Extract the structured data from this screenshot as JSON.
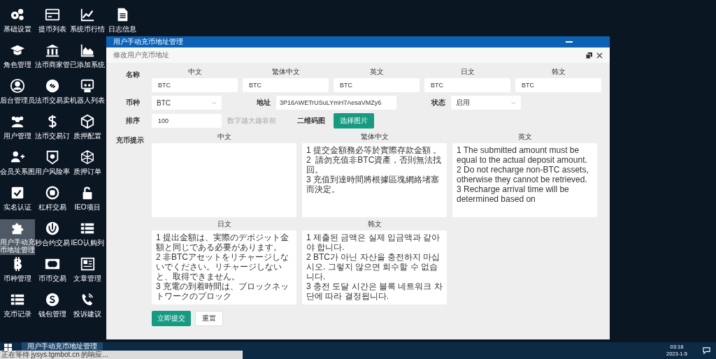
{
  "shortcut_rows": [
    {
      "items": [
        {
          "label": "基础设置",
          "selected": false
        },
        {
          "label": "提币列表",
          "selected": false
        },
        {
          "label": "系统币行情",
          "selected": false
        },
        {
          "label": "日志信息",
          "selected": false
        }
      ]
    },
    {
      "items": [
        {
          "label": "角色管理",
          "selected": false
        },
        {
          "label": "法币商家管",
          "selected": false
        },
        {
          "label": "已添加系统",
          "selected": false
        }
      ]
    },
    {
      "items": [
        {
          "label": "后台管理员",
          "selected": false
        },
        {
          "label": "法币交易卖",
          "selected": false
        },
        {
          "label": "机器人列表",
          "selected": false
        }
      ]
    },
    {
      "items": [
        {
          "label": "用户管理",
          "selected": false
        },
        {
          "label": "法币交易订",
          "selected": false
        },
        {
          "label": "质押配置",
          "selected": false
        }
      ]
    },
    {
      "items": [
        {
          "label": "会员关系图",
          "selected": false
        },
        {
          "label": "用户风险率",
          "selected": false
        },
        {
          "label": "质押订单",
          "selected": false
        }
      ]
    },
    {
      "items": [
        {
          "label": "实名认证",
          "selected": false
        },
        {
          "label": "杠杆交易",
          "selected": false
        },
        {
          "label": "IEO项目",
          "selected": false
        }
      ]
    },
    {
      "items": [
        {
          "label": "用户手动充币地址管理",
          "selected": true
        },
        {
          "label": "秒合约交易",
          "selected": false
        },
        {
          "label": "IEO认购列",
          "selected": false
        }
      ]
    },
    {
      "items": [
        {
          "label": "币种管理",
          "selected": false
        },
        {
          "label": "币币交易",
          "selected": false
        },
        {
          "label": "文章管理",
          "selected": false
        }
      ]
    },
    {
      "items": [
        {
          "label": "充币记录",
          "selected": false
        },
        {
          "label": "钱包管理",
          "selected": false
        },
        {
          "label": "投诉建议",
          "selected": false
        }
      ]
    }
  ],
  "window": {
    "title": "用户手动充币地址管理",
    "subtitle": "修改用户充币地址"
  },
  "form": {
    "name": {
      "label": "名称",
      "fields": [
        {
          "lang": "中文",
          "value": "BTC"
        },
        {
          "lang": "繁体中文",
          "value": "BTC"
        },
        {
          "lang": "英文",
          "value": "BTC"
        },
        {
          "lang": "日文",
          "value": "BTC"
        },
        {
          "lang": "韩文",
          "value": "BTC"
        }
      ]
    },
    "coin": {
      "label": "币种",
      "value": "BTC"
    },
    "address": {
      "label": "地址",
      "value": "3P16AWETrUSuLYmH7AesaVMZy6"
    },
    "status": {
      "label": "状态",
      "value": "启用"
    },
    "sort": {
      "label": "排序",
      "value": "100",
      "hint": "数字越大越靠前"
    },
    "qr": {
      "label": "二维码图",
      "button": "选择图片"
    },
    "tips": {
      "label": "充币提示",
      "fields": [
        {
          "lang": "中文"
        },
        {
          "lang": "繁体中文",
          "text": "1 提交金額務必等於實際存款金額 。\n2  請勿充值非BTC資產，否則無法找回。\n3 充值到達時間將根據區塊網絡堵塞而決定。"
        },
        {
          "lang": "英文",
          "text": "1 The submitted amount must be equal to the actual deposit amount.\n2 Do not recharge non-BTC assets, otherwise they cannot be retrieved.\n3 Recharge arrival time will be determined based on"
        },
        {
          "lang": "日文",
          "text": "1 提出金額は、実際のデポジット金額と同じである必要があります。\n2 非BTCアセットをリチャージしないでください。リチャージしないと、取得できません。\n3 充電の到着時間は、ブロックネットワークのブロック"
        },
        {
          "lang": "韩文",
          "text": "1 제출된 금액은 실제 입금액과 같아야 합니다.\n2 BTC가 아닌 자산을 충전하지 마십시오. 그렇지 않으면 회수할 수 없습니다.\n3 충전 도달 시간은 블록 네트워크 차단에 따라 결정됩니다."
        }
      ]
    },
    "buttons": {
      "submit": "立即提交",
      "reset": "重置"
    }
  },
  "taskbar": {
    "app": "用户手动充币地址管理",
    "time": "03:18",
    "date": "2023-1-5"
  },
  "status_bar": "正在等待 jysys.tgmbot.cn 的响应..."
}
